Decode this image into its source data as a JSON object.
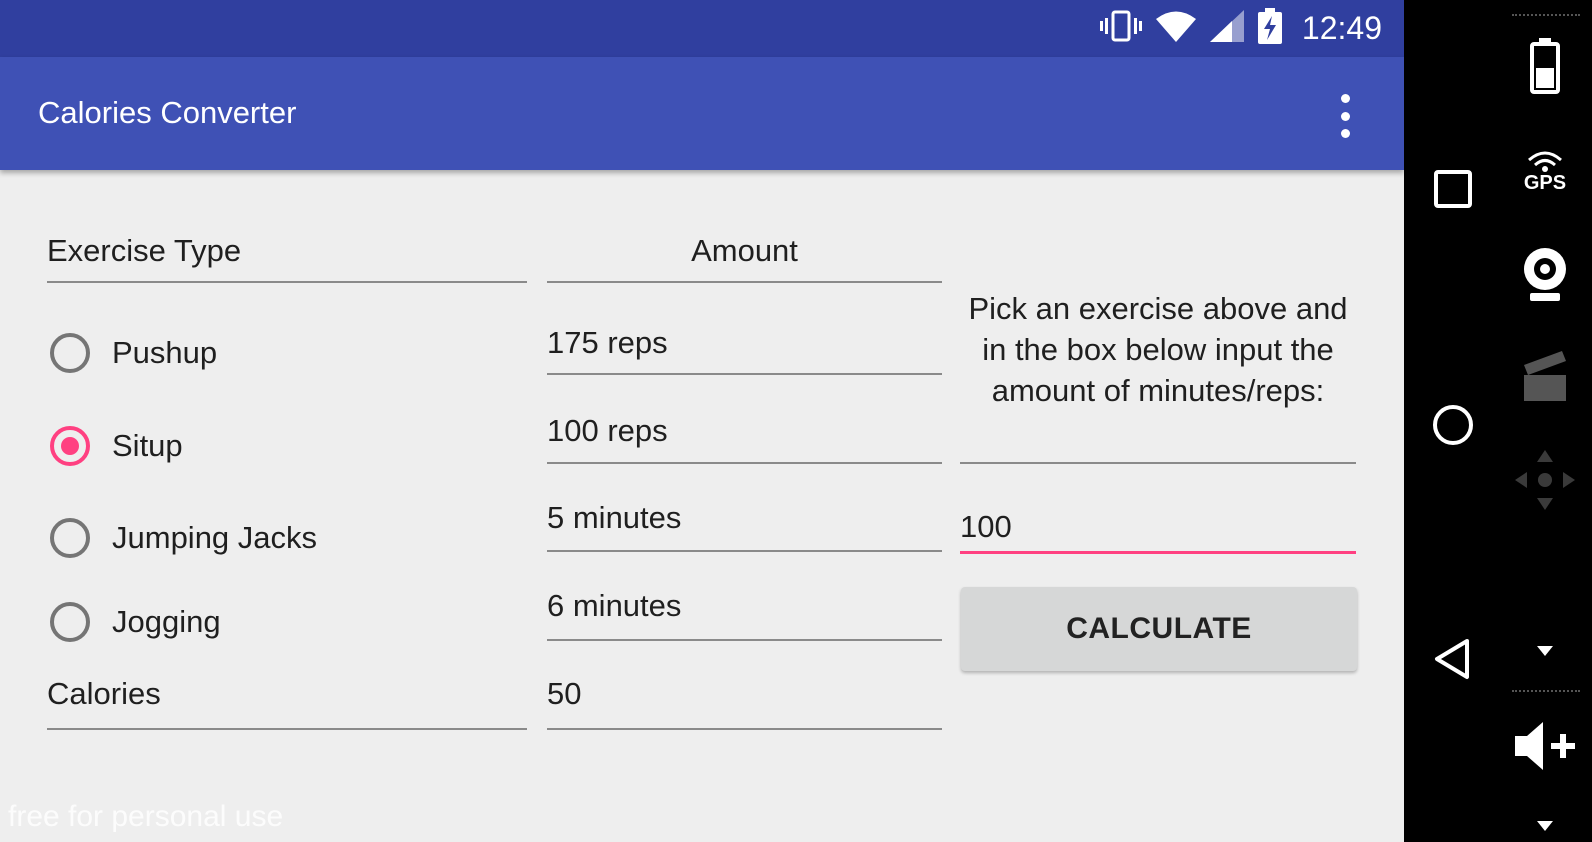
{
  "status_bar": {
    "time": "12:49",
    "icons": [
      "vibrate-icon",
      "wifi-icon",
      "cell-signal-icon",
      "battery-charging-icon"
    ]
  },
  "app_bar": {
    "title": "Calories Converter",
    "overflow_icon": "more-vert-icon"
  },
  "table": {
    "exercise_header": "Exercise Type",
    "amount_header": "Amount",
    "rows": [
      {
        "label": "Pushup",
        "amount": "175 reps",
        "checked": false
      },
      {
        "label": "Situp",
        "amount": "100 reps",
        "checked": true
      },
      {
        "label": "Jumping Jacks",
        "amount": "5 minutes",
        "checked": false
      },
      {
        "label": "Jogging",
        "amount": "6 minutes",
        "checked": false
      }
    ],
    "calories_label": "Calories",
    "calories_value": "50"
  },
  "side_panel": {
    "instruction": "Pick an exercise above and in the box below input the amount of minutes/reps:",
    "input_value": "100",
    "calculate_label": "CALCULATE"
  },
  "watermark": "free for personal use",
  "emulator_controls": {
    "gps_label": "GPS",
    "items": [
      "battery-icon",
      "gps-icon",
      "webcam-icon",
      "clapper-icon",
      "dpad-icon",
      "volume-up-icon"
    ]
  },
  "colors": {
    "primary_dark": "#303f9f",
    "primary": "#3f51b5",
    "accent": "#ff4081",
    "background": "#eeeeee"
  }
}
